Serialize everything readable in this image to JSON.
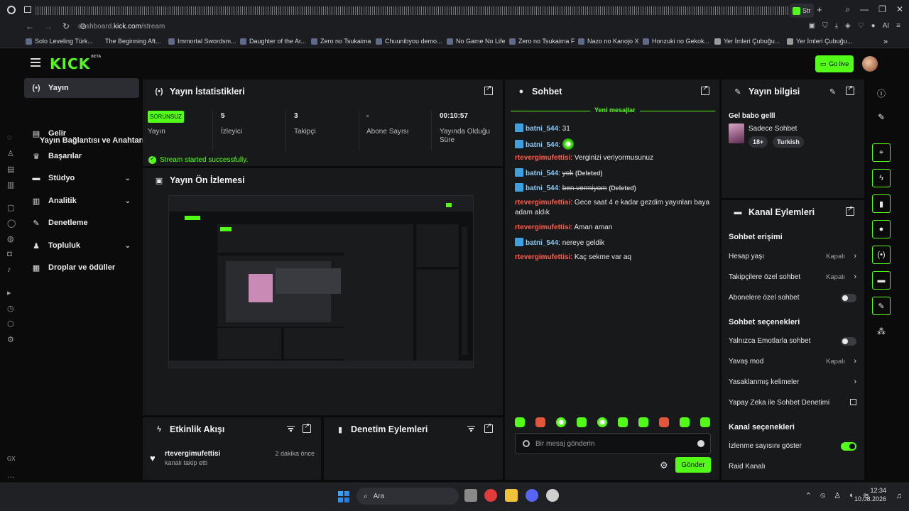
{
  "browser": {
    "active_tab_label": "Str",
    "url_prefix": "dashboard.",
    "url_domain": "kick.com",
    "url_path": "/stream",
    "ai_label": "AI",
    "bookmarks": [
      "Solo Leveling Türk...",
      "The Beginning Aft...",
      "Immortal Swordsm...",
      "Daughter of the Ar...",
      "Zero no Tsukaima",
      "Chuunibyou demo...",
      "No Game No Life",
      "Zero no Tsukaima F",
      "Nazo no Kanojo X",
      "Honzuki no Gekok...",
      "Yer İmleri Çubuğu...",
      "Yer İmleri Çubuğu..."
    ]
  },
  "header": {
    "logo": "KICK",
    "logo_beta": "BETA",
    "go_live_label": "Go live"
  },
  "sidebar": {
    "items": [
      {
        "label": "Yayın",
        "icon": "broadcast-icon"
      },
      {
        "label": "Yayın Bağlantısı ve Anahtarı"
      },
      {
        "label": "Gelir",
        "icon": "chart-icon"
      },
      {
        "label": "Başarılar",
        "icon": "trophy-icon"
      },
      {
        "label": "Stüdyo",
        "icon": "studio-icon"
      },
      {
        "label": "Analitik",
        "icon": "analytics-icon"
      },
      {
        "label": "Denetleme",
        "icon": "wrench-icon"
      },
      {
        "label": "Topluluk",
        "icon": "community-icon"
      },
      {
        "label": "Droplar ve ödüller",
        "icon": "gift-icon"
      }
    ],
    "rail_footer": "GX"
  },
  "stats_panel": {
    "title": "Yayın İstatistikleri",
    "status_badge": "SORUNSUZ",
    "stats": [
      {
        "value": "",
        "label": "Yayın"
      },
      {
        "value": "5",
        "label": "İzleyici"
      },
      {
        "value": "3",
        "label": "Takipçi"
      },
      {
        "value": "-",
        "label": "Abone Sayısı"
      },
      {
        "value": "00:10:57",
        "label": "Yayında Olduğu Süre"
      }
    ],
    "success_message": "Stream started successfully."
  },
  "preview_panel": {
    "title": "Yayın Ön İzlemesi"
  },
  "activity_panel": {
    "title": "Etkinlik Akışı",
    "events": [
      {
        "user": "rtevergimufettisi",
        "text": "kanalı takip etti",
        "time": "2 dakika önce"
      }
    ]
  },
  "moderation_panel": {
    "title": "Denetim Eylemleri"
  },
  "chat": {
    "title": "Sohbet",
    "new_messages_label": "Yeni mesajlar",
    "messages": [
      {
        "user": "batni_544",
        "text": "31",
        "deleted": false
      },
      {
        "user": "batni_544",
        "text": "",
        "deleted": false
      },
      {
        "user": "rtevergimufettisi",
        "text": "Verginizi veriyormusunuz",
        "deleted": false
      },
      {
        "user": "batni_544",
        "text": "yok",
        "deleted": true
      },
      {
        "user": "batni_544",
        "text": "ben vermiyom",
        "deleted": true
      },
      {
        "user": "rtevergimufettisi",
        "text": "Gece saat 4 e kadar gezdim yayınları baya adam aldık",
        "deleted": false
      },
      {
        "user": "rtevergimufettisi",
        "text": "Aman aman",
        "deleted": false
      },
      {
        "user": "batni_544",
        "text": "nereye geldik",
        "deleted": false
      },
      {
        "user": "rtevergimufettisi",
        "text": "Kaç sekme var aq",
        "deleted": false
      }
    ],
    "deleted_label": "(Deleted)",
    "input_placeholder": "Bir mesaj gönderin",
    "send_label": "Gönder"
  },
  "stream_info": {
    "title": "Yayın bilgisi",
    "stream_title": "Gel babo gelll",
    "category": "Sadece Sohbet",
    "tags": [
      "18+",
      "Turkish"
    ]
  },
  "channel_actions": {
    "title": "Kanal Eylemleri",
    "chat_access_header": "Sohbet erişimi",
    "account_age": {
      "label": "Hesap yaşı",
      "value": "Kapalı"
    },
    "followers_only": {
      "label": "Takipçilere özel sohbet",
      "value": "Kapalı"
    },
    "subscribers_only": {
      "label": "Abonelere özel sohbet",
      "on": false
    },
    "chat_options_header": "Sohbet seçenekleri",
    "emotes_only": {
      "label": "Yalnızca Emotlarla sohbet",
      "on": false
    },
    "slow_mode": {
      "label": "Yavaş mod",
      "value": "Kapalı"
    },
    "banned_words": {
      "label": "Yasaklanmış kelimeler"
    },
    "ai_moderation": {
      "label": "Yapay Zeka ile Sohbet Denetimi"
    },
    "channel_options_header": "Kanal seçenekleri",
    "show_viewers": {
      "label": "İzlenme sayısını göster",
      "on": true
    },
    "raid": {
      "label": "Raid Kanalı"
    }
  },
  "taskbar": {
    "search_label": "Ara",
    "time": "12:34",
    "date": "10.08.2026"
  },
  "colors": {
    "accent": "#53fc18",
    "panel": "#18191b",
    "bg": "#0b0b0c",
    "chat_user_red": "#ff5b4a",
    "chat_user_blue": "#8ec8ef"
  }
}
